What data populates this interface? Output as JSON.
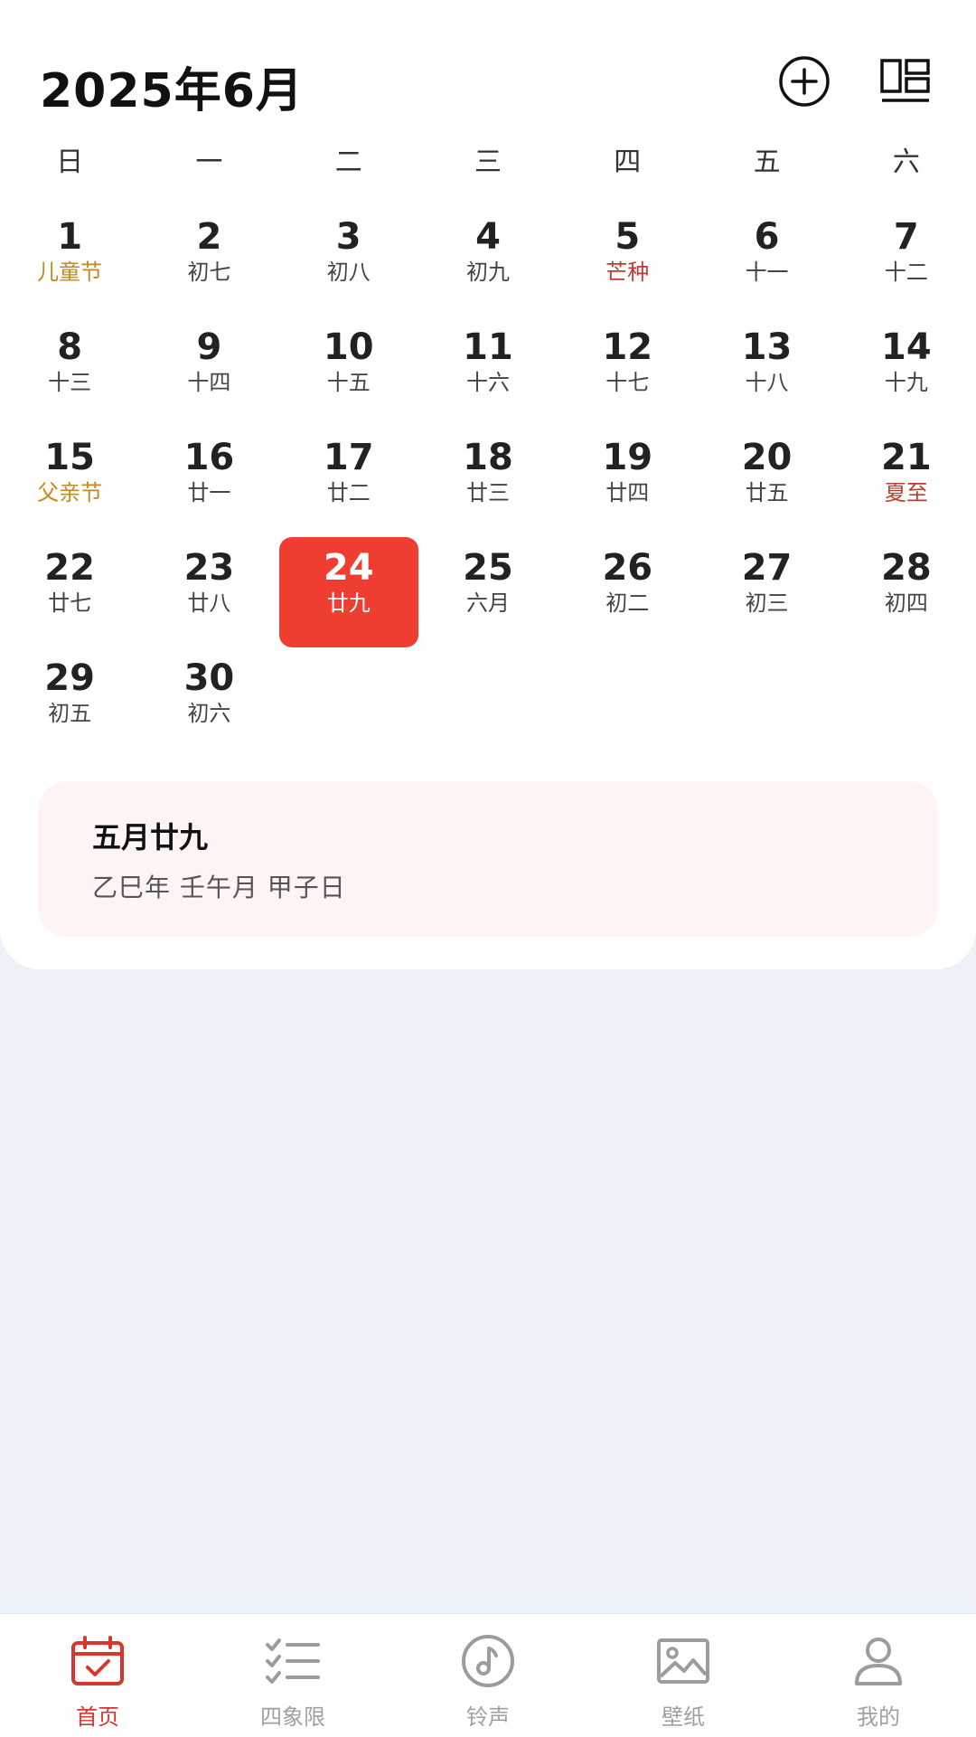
{
  "header": {
    "title": "2025年6月",
    "add_icon": "plus-circle-icon",
    "layout_icon": "layout-grid-icon"
  },
  "weekdays": [
    "日",
    "一",
    "二",
    "三",
    "四",
    "五",
    "六"
  ],
  "colors": {
    "selected_bg": "#F03D32",
    "festival": "#C28A22",
    "solar_term": "#C13A32",
    "nav_active": "#D9372E",
    "nav_inactive": "#A0A0A0"
  },
  "days": [
    {
      "day": "1",
      "lunar": "儿童节",
      "kind": "festival"
    },
    {
      "day": "2",
      "lunar": "初七"
    },
    {
      "day": "3",
      "lunar": "初八"
    },
    {
      "day": "4",
      "lunar": "初九"
    },
    {
      "day": "5",
      "lunar": "芒种",
      "kind": "term"
    },
    {
      "day": "6",
      "lunar": "十一"
    },
    {
      "day": "7",
      "lunar": "十二"
    },
    {
      "day": "8",
      "lunar": "十三"
    },
    {
      "day": "9",
      "lunar": "十四"
    },
    {
      "day": "10",
      "lunar": "十五"
    },
    {
      "day": "11",
      "lunar": "十六"
    },
    {
      "day": "12",
      "lunar": "十七"
    },
    {
      "day": "13",
      "lunar": "十八"
    },
    {
      "day": "14",
      "lunar": "十九"
    },
    {
      "day": "15",
      "lunar": "父亲节",
      "kind": "festival"
    },
    {
      "day": "16",
      "lunar": "廿一"
    },
    {
      "day": "17",
      "lunar": "廿二"
    },
    {
      "day": "18",
      "lunar": "廿三"
    },
    {
      "day": "19",
      "lunar": "廿四"
    },
    {
      "day": "20",
      "lunar": "廿五"
    },
    {
      "day": "21",
      "lunar": "夏至",
      "kind": "term"
    },
    {
      "day": "22",
      "lunar": "廿七"
    },
    {
      "day": "23",
      "lunar": "廿八"
    },
    {
      "day": "24",
      "lunar": "廿九",
      "selected": true
    },
    {
      "day": "25",
      "lunar": "六月"
    },
    {
      "day": "26",
      "lunar": "初二"
    },
    {
      "day": "27",
      "lunar": "初三"
    },
    {
      "day": "28",
      "lunar": "初四"
    },
    {
      "day": "29",
      "lunar": "初五"
    },
    {
      "day": "30",
      "lunar": "初六"
    }
  ],
  "info": {
    "title": "五月廿九",
    "subtitle": "乙巳年 壬午月 甲子日"
  },
  "nav": [
    {
      "label": "首页",
      "icon": "calendar-check-icon",
      "active": true
    },
    {
      "label": "四象限",
      "icon": "checklist-icon"
    },
    {
      "label": "铃声",
      "icon": "music-note-icon"
    },
    {
      "label": "壁纸",
      "icon": "image-icon"
    },
    {
      "label": "我的",
      "icon": "user-icon"
    }
  ]
}
